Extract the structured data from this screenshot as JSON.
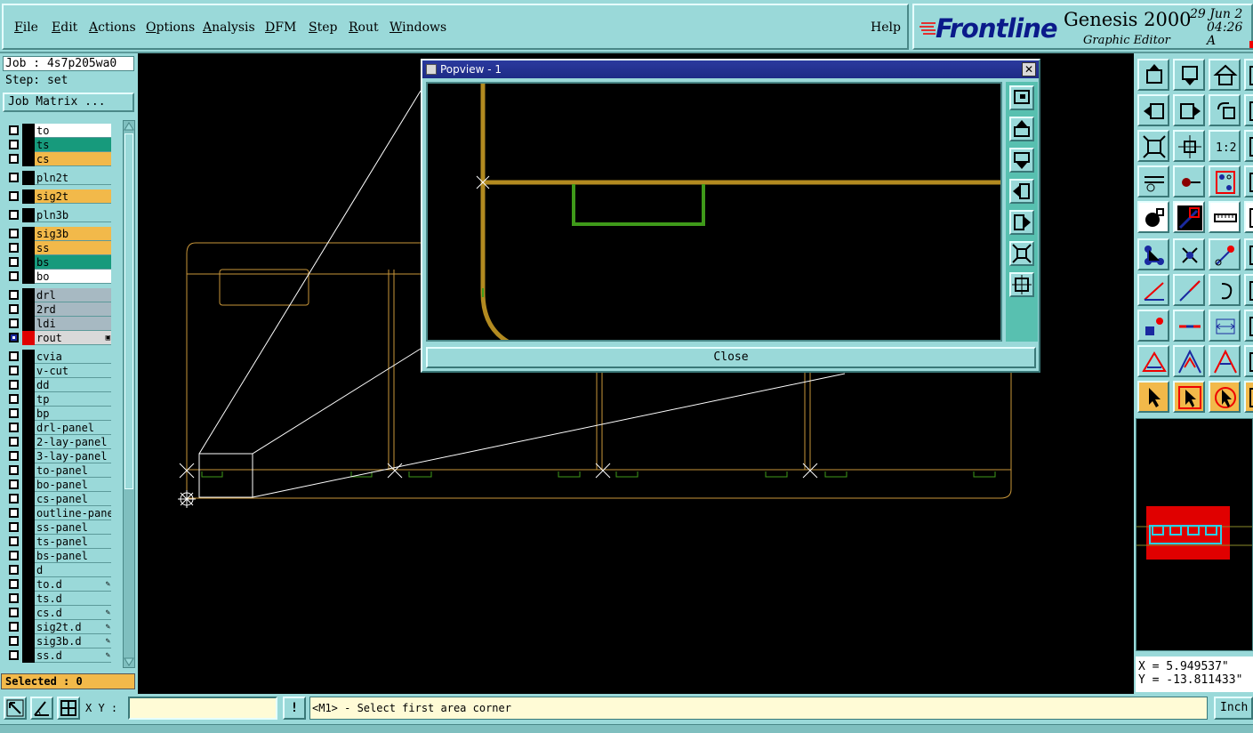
{
  "menu": {
    "items": [
      {
        "u": "F",
        "rest": "ile"
      },
      {
        "u": "E",
        "rest": "dit"
      },
      {
        "u": "A",
        "rest": "ctions"
      },
      {
        "u": "O",
        "rest": "ptions"
      },
      {
        "u": "A",
        "rest": "nalysis"
      },
      {
        "u": "D",
        "rest": "FM"
      },
      {
        "u": "S",
        "rest": "tep"
      },
      {
        "u": "R",
        "rest": "out"
      },
      {
        "u": "W",
        "rest": "indows"
      }
    ],
    "help": "Help"
  },
  "brand": {
    "logo": "Frontline",
    "title": "Genesis 2000",
    "subtitle": "Graphic Editor",
    "date": "29 Jun 2",
    "time": "04:26 A"
  },
  "job": {
    "job_label": "Job : 4s7p205wa0",
    "step_label": "Step: set",
    "matrix_button": "Job Matrix ..."
  },
  "layers": [
    {
      "name": "to",
      "color": "#ffffff"
    },
    {
      "name": "ts",
      "color": "#179a7c"
    },
    {
      "name": "cs",
      "color": "#f2b94a"
    },
    {
      "name": "pln2t",
      "color": "#9ad9d9",
      "gap": true
    },
    {
      "name": "sig2t",
      "color": "#f2b94a",
      "gap": true
    },
    {
      "name": "pln3b",
      "color": "#9ad9d9",
      "gap": true
    },
    {
      "name": "sig3b",
      "color": "#f2b94a",
      "gap": true
    },
    {
      "name": "ss",
      "color": "#f2b94a"
    },
    {
      "name": "bs",
      "color": "#179a7c"
    },
    {
      "name": "bo",
      "color": "#ffffff"
    },
    {
      "name": "drl",
      "color": "#a7b9c2",
      "gap": true
    },
    {
      "name": "2rd",
      "color": "#a7b9c2"
    },
    {
      "name": "ldi",
      "color": "#a7b9c2"
    },
    {
      "name": "rout",
      "color": "#d9d9d9",
      "active": true
    },
    {
      "name": "cvia",
      "color": "#9ad9d9",
      "gap": true
    },
    {
      "name": "v-cut",
      "color": "#9ad9d9"
    },
    {
      "name": "dd",
      "color": "#9ad9d9"
    },
    {
      "name": "tp",
      "color": "#9ad9d9"
    },
    {
      "name": "bp",
      "color": "#9ad9d9"
    },
    {
      "name": "drl-panel",
      "color": "#9ad9d9"
    },
    {
      "name": "2-lay-panel",
      "color": "#9ad9d9"
    },
    {
      "name": "3-lay-panel",
      "color": "#9ad9d9"
    },
    {
      "name": "to-panel",
      "color": "#9ad9d9"
    },
    {
      "name": "bo-panel",
      "color": "#9ad9d9"
    },
    {
      "name": "cs-panel",
      "color": "#9ad9d9"
    },
    {
      "name": "outline-panel",
      "color": "#9ad9d9"
    },
    {
      "name": "ss-panel",
      "color": "#9ad9d9"
    },
    {
      "name": "ts-panel",
      "color": "#9ad9d9"
    },
    {
      "name": "bs-panel",
      "color": "#9ad9d9"
    },
    {
      "name": "d",
      "color": "#9ad9d9"
    },
    {
      "name": "to.d",
      "color": "#9ad9d9",
      "mark": true
    },
    {
      "name": "ts.d",
      "color": "#9ad9d9"
    },
    {
      "name": "cs.d",
      "color": "#9ad9d9",
      "mark": true
    },
    {
      "name": "sig2t.d",
      "color": "#9ad9d9",
      "mark": true
    },
    {
      "name": "sig3b.d",
      "color": "#9ad9d9",
      "mark": true
    },
    {
      "name": "ss.d",
      "color": "#9ad9d9",
      "mark": true
    }
  ],
  "selected": "Selected : 0",
  "popview": {
    "title": "Popview - 1",
    "close_x": "✕",
    "close_button": "Close"
  },
  "overview": {
    "highlight": "#e00000"
  },
  "coords": {
    "x": "X = 5.949537\"",
    "y": "Y = -13.811433\""
  },
  "bottom": {
    "xy_label": "X Y :",
    "xy_value": "",
    "bang": "!",
    "prompt": "<M1> - Select first area corner",
    "units": "Inch"
  },
  "colors": {
    "panel": "#9ad9d9",
    "outline": "#c8963a",
    "profile": "#b28a20",
    "green": "#3f9a1a",
    "white_line": "#ffffff"
  }
}
